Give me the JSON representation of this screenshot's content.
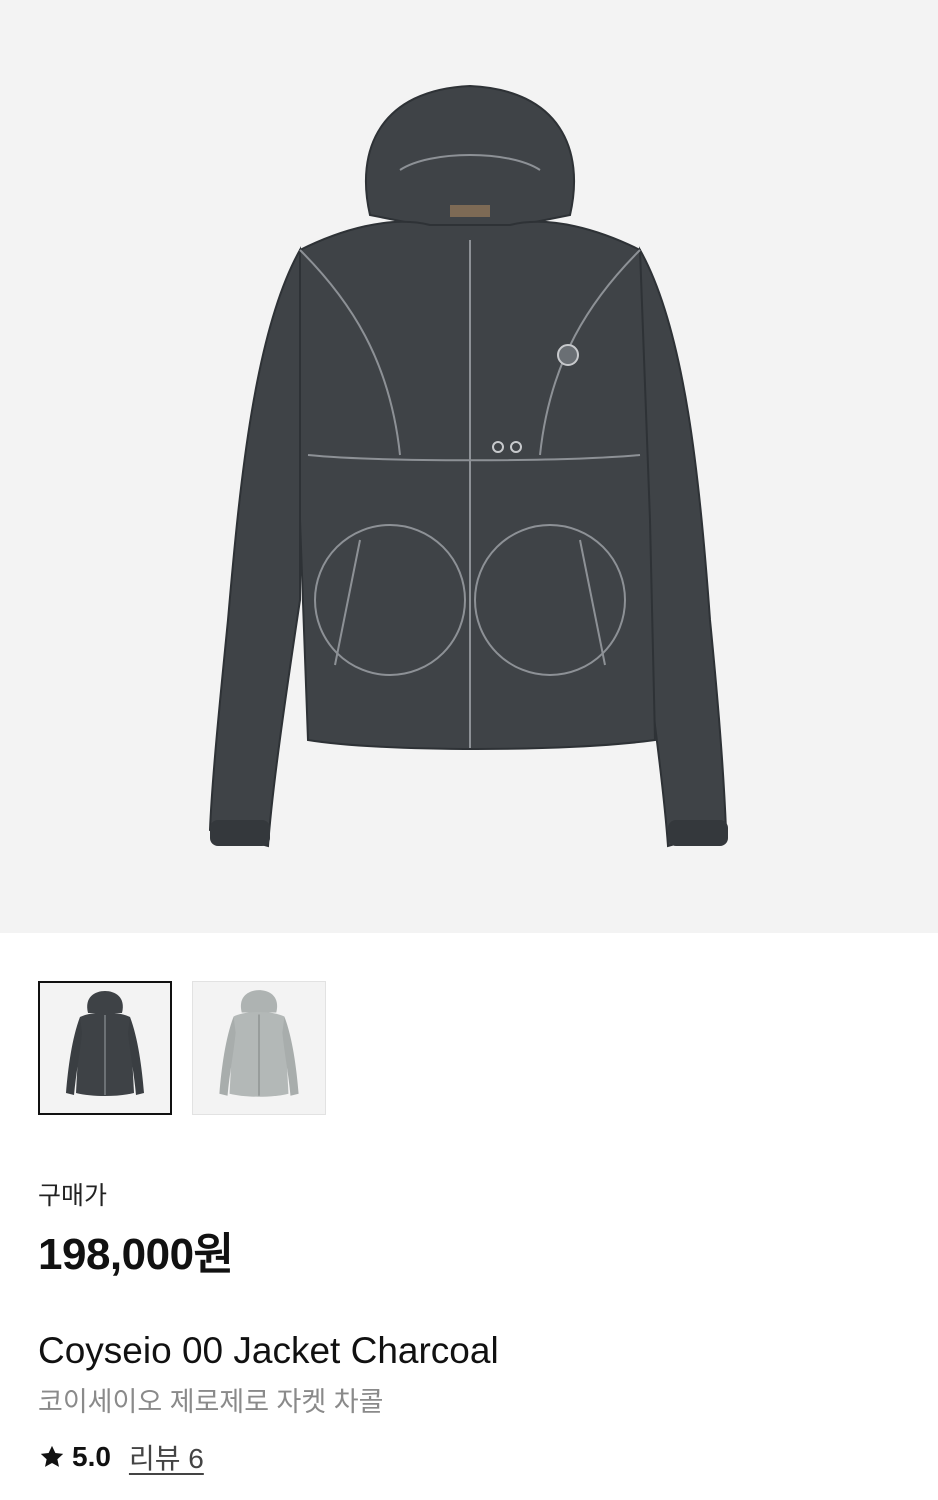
{
  "product": {
    "hero_image": "charcoal-hooded-jacket-photo",
    "thumbnails": [
      {
        "name": "charcoal",
        "color": "#3e4246",
        "selected": true
      },
      {
        "name": "light-grey",
        "color": "#aeb3b2",
        "selected": false
      }
    ],
    "price_label": "구매가",
    "price": "198,000원",
    "title": "Coyseio 00 Jacket Charcoal",
    "subtitle": "코이세이오 제로제로 자켓 차콜",
    "rating": "5.0",
    "review_text": "리뷰 6",
    "star_icon": "star-icon"
  }
}
